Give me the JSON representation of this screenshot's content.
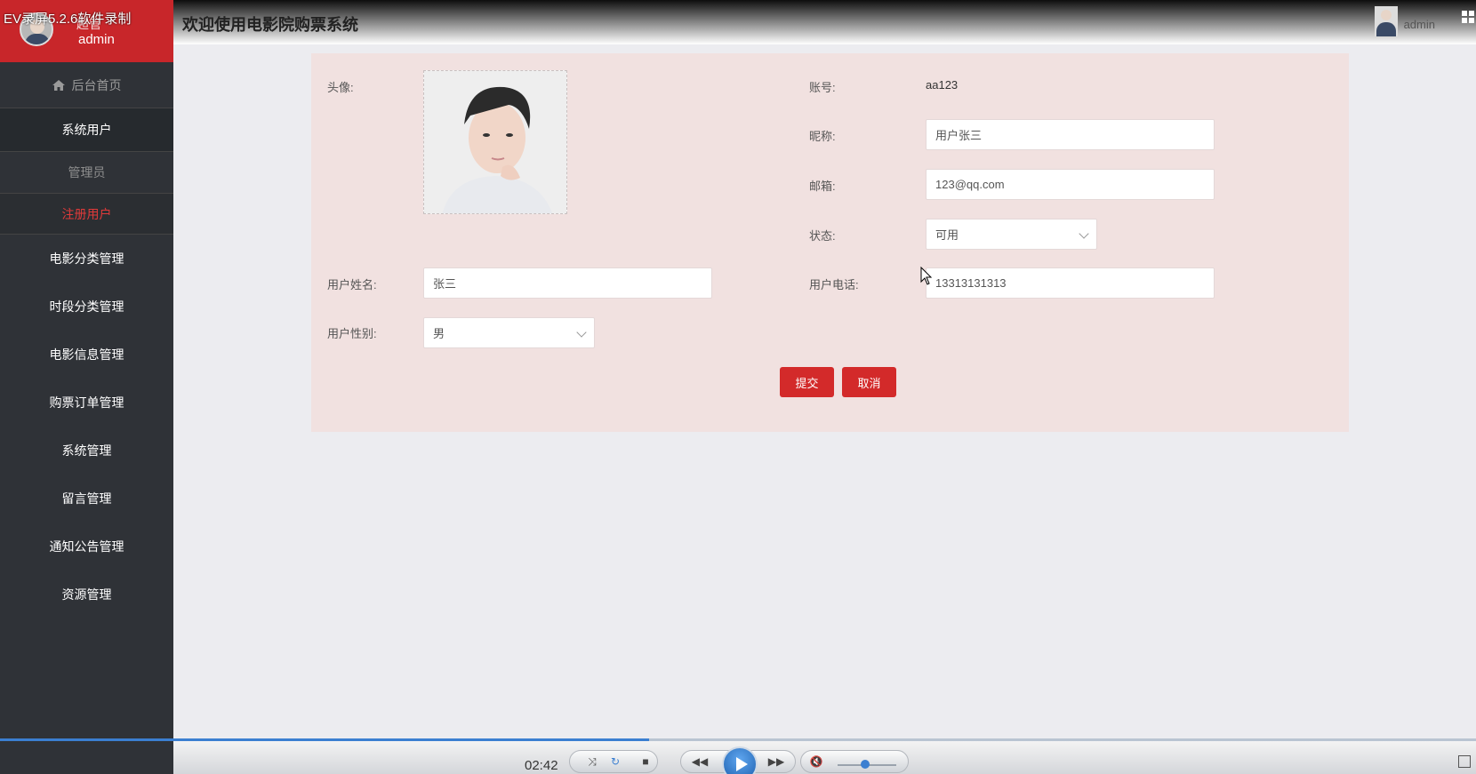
{
  "watermark": "EV录屏5.2.6软件录制",
  "sidebar": {
    "role": "超管",
    "user": "admin",
    "home": "后台首页",
    "items": [
      {
        "label": "系统用户"
      },
      {
        "label": "管理员"
      },
      {
        "label": "注册用户"
      },
      {
        "label": "电影分类管理"
      },
      {
        "label": "时段分类管理"
      },
      {
        "label": "电影信息管理"
      },
      {
        "label": "购票订单管理"
      },
      {
        "label": "系统管理"
      },
      {
        "label": "留言管理"
      },
      {
        "label": "通知公告管理"
      },
      {
        "label": "资源管理"
      }
    ]
  },
  "header": {
    "title": "欢迎使用电影院购票系统",
    "user": "admin"
  },
  "form": {
    "avatar_label": "头像:",
    "account_label": "账号:",
    "account_value": "aa123",
    "nickname_label": "昵称:",
    "nickname_value": "用户张三",
    "email_label": "邮箱:",
    "email_value": "123@qq.com",
    "status_label": "状态:",
    "status_value": "可用",
    "name_label": "用户姓名:",
    "name_value": "张三",
    "phone_label": "用户电话:",
    "phone_value": "13313131313",
    "gender_label": "用户性别:",
    "gender_value": "男",
    "submit_label": "提交",
    "cancel_label": "取消"
  },
  "player": {
    "time": "02:42",
    "progress": 0.44,
    "accent": "#3b7fd1"
  },
  "colors": {
    "brand_red": "#c8262a",
    "sidebar_bg": "#2f3237",
    "panel_bg": "#f1e1e0"
  }
}
